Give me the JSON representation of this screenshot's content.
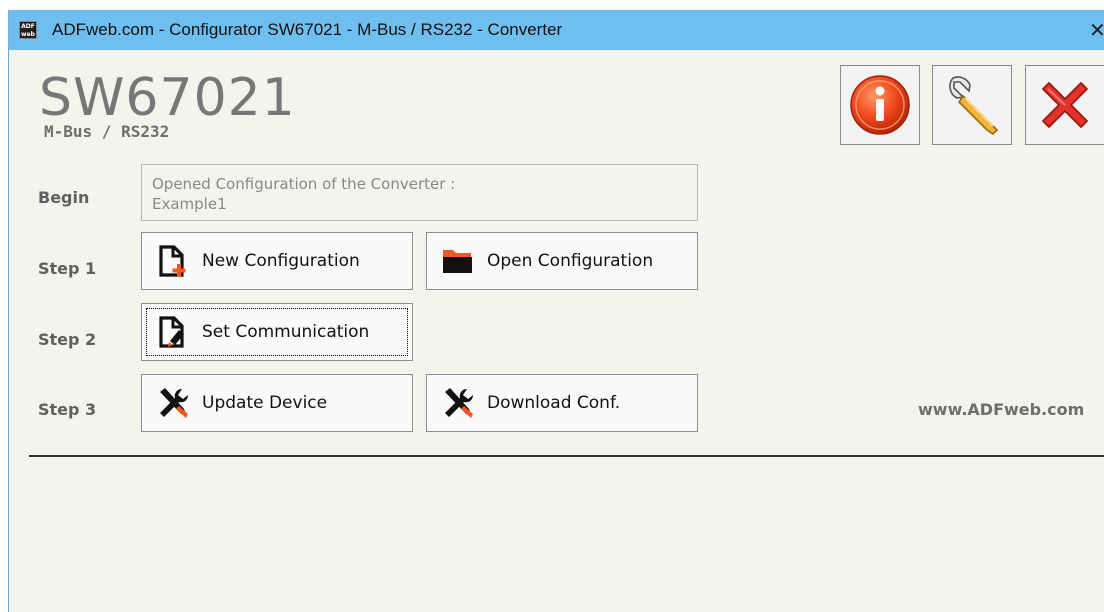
{
  "window": {
    "icon_text": "ADF web",
    "title": "ADFweb.com - Configurator SW67021 - M-Bus / RS232 - Converter",
    "close_glyph": "✕"
  },
  "header": {
    "product": "SW67021",
    "subtitle": "M-Bus / RS232"
  },
  "toolbar": {
    "info_icon": "info-icon",
    "settings_icon": "wrench-icon",
    "exit_icon": "close-icon"
  },
  "steps": {
    "begin_label": "Begin",
    "step1_label": "Step 1",
    "step2_label": "Step 2",
    "step3_label": "Step 3"
  },
  "status": {
    "line1": "Opened Configuration of the Converter :",
    "line2": "Example1"
  },
  "buttons": {
    "new_config": "New Configuration",
    "open_config": "Open Configuration",
    "set_comm": "Set Communication",
    "update_device": "Update Device",
    "download_conf": "Download Conf."
  },
  "footer": {
    "website": "www.ADFweb.com"
  },
  "colors": {
    "titlebar": "#6fbef0",
    "background": "#f5f4ec",
    "accent_orange": "#f05a22",
    "exit_red": "#e2332a"
  }
}
